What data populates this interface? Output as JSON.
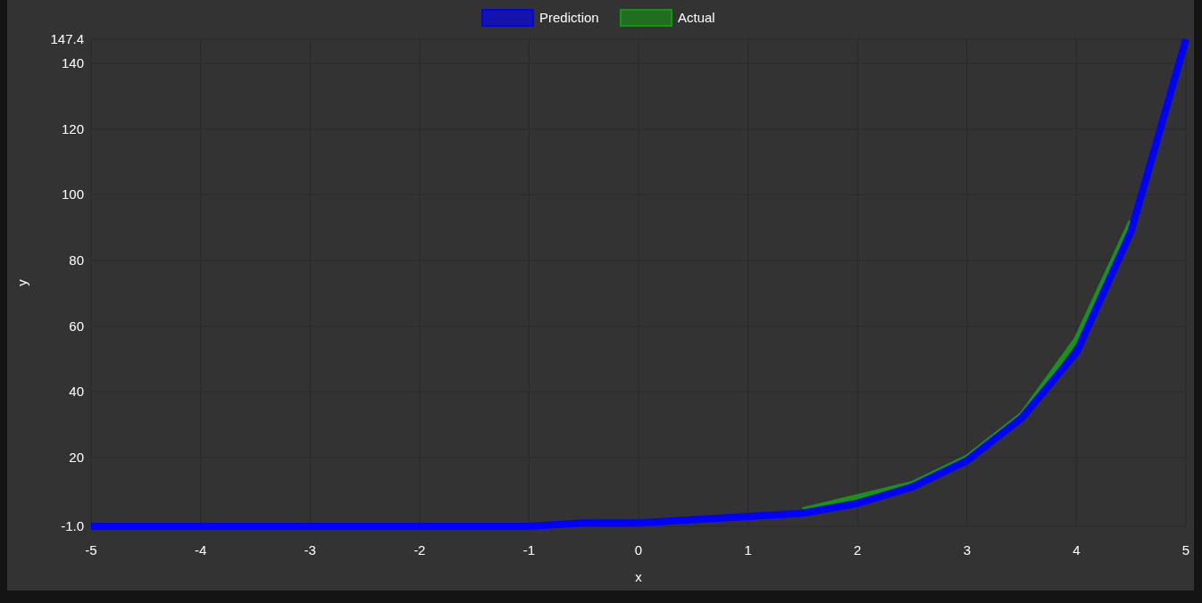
{
  "chart": {
    "chart_data": {
      "type": "line",
      "xlabel": "x",
      "ylabel": "y",
      "grid": true,
      "legend": true,
      "x": [
        -5,
        -4.5,
        -4,
        -3.5,
        -3,
        -2.5,
        -2,
        -1.5,
        -1,
        -0.5,
        0,
        0.5,
        1,
        1.5,
        2,
        2.5,
        3,
        3.5,
        4,
        4.5,
        5
      ],
      "series": [
        {
          "name": "Prediction",
          "color": "#0000ff",
          "values": [
            -1,
            -1,
            -1,
            -1,
            -1,
            -1,
            -1,
            -1,
            -1,
            0,
            0,
            1,
            2,
            3,
            6,
            11,
            19,
            32,
            52,
            89,
            147.4
          ]
        },
        {
          "name": "Actual",
          "color": "#149614",
          "values": [
            null,
            null,
            null,
            null,
            null,
            null,
            null,
            null,
            null,
            null,
            null,
            null,
            null,
            4,
            8,
            12,
            20,
            33,
            56,
            92,
            null
          ]
        }
      ],
      "xlim": [
        -5,
        5
      ],
      "ylim": [
        -1,
        147.4
      ],
      "xticks": [
        -5,
        -4,
        -3,
        -2,
        -1,
        0,
        1,
        2,
        3,
        4,
        5
      ],
      "yticks": [
        {
          "value": -1,
          "label": "-1.0"
        },
        20,
        40,
        60,
        80,
        100,
        120,
        140,
        {
          "value": 147.4,
          "label": "147.4"
        }
      ]
    }
  }
}
